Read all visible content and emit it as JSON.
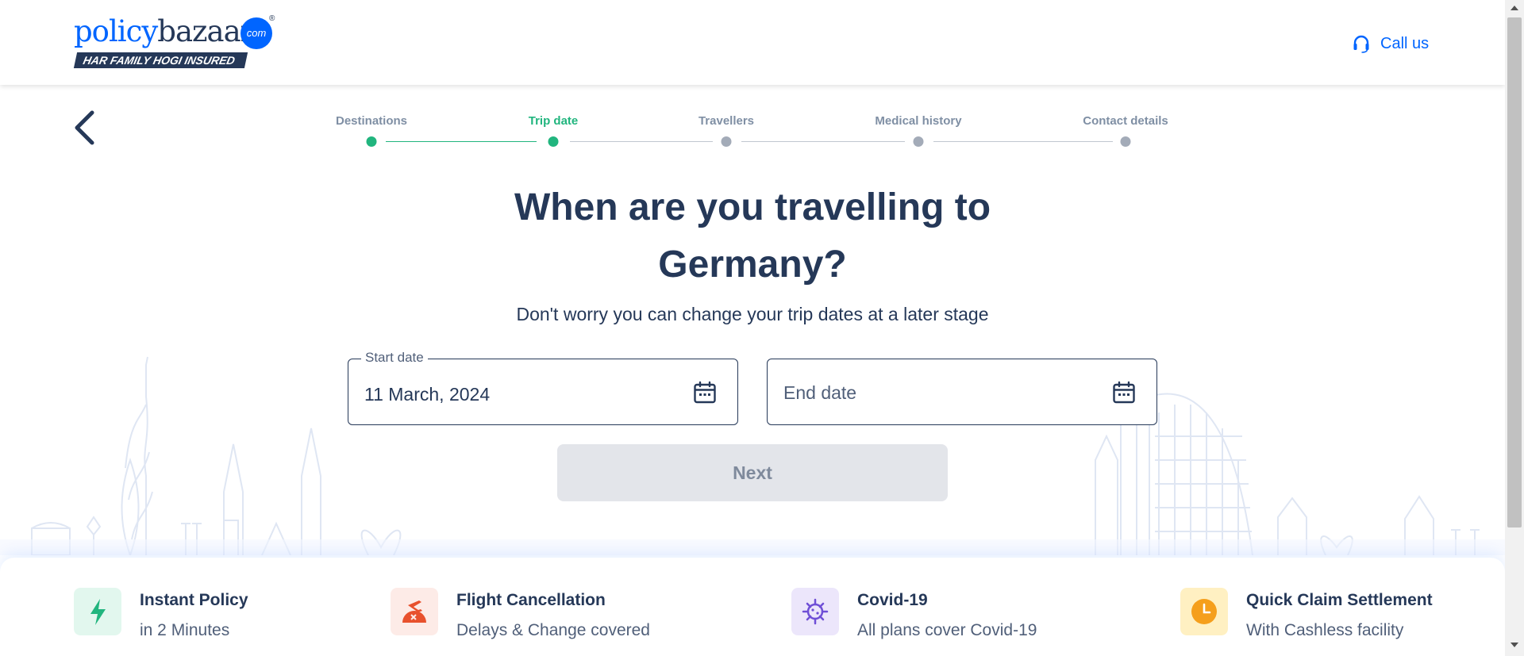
{
  "header": {
    "logo": {
      "word_part1": "policy",
      "word_part2": "bazaar",
      "badge": "com",
      "registered": "®",
      "tagline": "HAR FAMILY HOGI INSURED"
    },
    "call_us": "Call us"
  },
  "steps": [
    {
      "label": "Destinations",
      "state": "done"
    },
    {
      "label": "Trip date",
      "state": "active"
    },
    {
      "label": "Travellers",
      "state": "pending"
    },
    {
      "label": "Medical history",
      "state": "pending"
    },
    {
      "label": "Contact details",
      "state": "pending"
    }
  ],
  "main": {
    "title_line1": "When are you travelling to",
    "title_line2": "Germany?",
    "subtitle": "Don't worry you can change your trip dates at a later stage",
    "start_date": {
      "label": "Start date",
      "value": "11 March, 2024"
    },
    "end_date": {
      "placeholder": "End date"
    },
    "next_label": "Next"
  },
  "benefits": [
    {
      "title": "Instant Policy",
      "subtitle": "in 2 Minutes",
      "icon": "lightning-icon"
    },
    {
      "title": "Flight Cancellation",
      "subtitle": "Delays & Change covered",
      "icon": "flight-cancel-icon"
    },
    {
      "title": "Covid-19",
      "subtitle": "All plans cover Covid-19",
      "icon": "virus-icon"
    },
    {
      "title": "Quick Claim Settlement",
      "subtitle": "With Cashless facility",
      "icon": "clock-icon"
    }
  ],
  "colors": {
    "brand_blue": "#0065ff",
    "navy": "#253858",
    "success_green": "#21b57e",
    "disabled_button": "#e3e5ea"
  }
}
